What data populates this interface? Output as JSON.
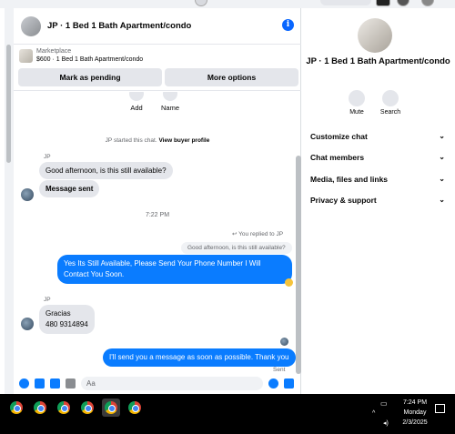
{
  "colors": {
    "messenger_blue": "#0a7cff",
    "bubble_gray": "#e4e6eb",
    "accent": "#0866ff",
    "taskbar": "#000000"
  },
  "chat": {
    "title": "JP · 1 Bed 1 Bath Apartment/condo",
    "listing": {
      "source": "Marketplace",
      "price_title": "$600 · 1 Bed 1 Bath Apartment/condo",
      "mark_pending": "Mark as pending",
      "more_options": "More options"
    },
    "actions": {
      "add": "Add",
      "name": "Name"
    },
    "started_text": "JP started this chat.",
    "buyer_profile_link": "View buyer profile",
    "sender_label": "JP",
    "msg1": "Good afternoon, is this still available?",
    "msg2": "Message sent",
    "timestamp": "7:22 PM",
    "replied_label": "You replied to JP",
    "quoted": "Good afternoon, is this still available?",
    "my_reply": "Yes Its Still Available, Please Send Your Phone Number I Will Contact You Soon.",
    "sender_label2": "JP",
    "msg3_line1": "Gracias",
    "msg3_line2": "480 9314894",
    "my_msg2": "I'll send you a message as soon as possible. Thank you",
    "sent_status": "Sent",
    "composer_placeholder": "Aa"
  },
  "info": {
    "title": "JP · 1 Bed 1 Bath Apartment/condo",
    "mute": "Mute",
    "search": "Search",
    "menu": [
      "Customize chat",
      "Chat members",
      "Media, files and links",
      "Privacy & support"
    ]
  },
  "taskbar": {
    "time": "7:24 PM",
    "day": "Monday",
    "date": "2/3/2025"
  }
}
